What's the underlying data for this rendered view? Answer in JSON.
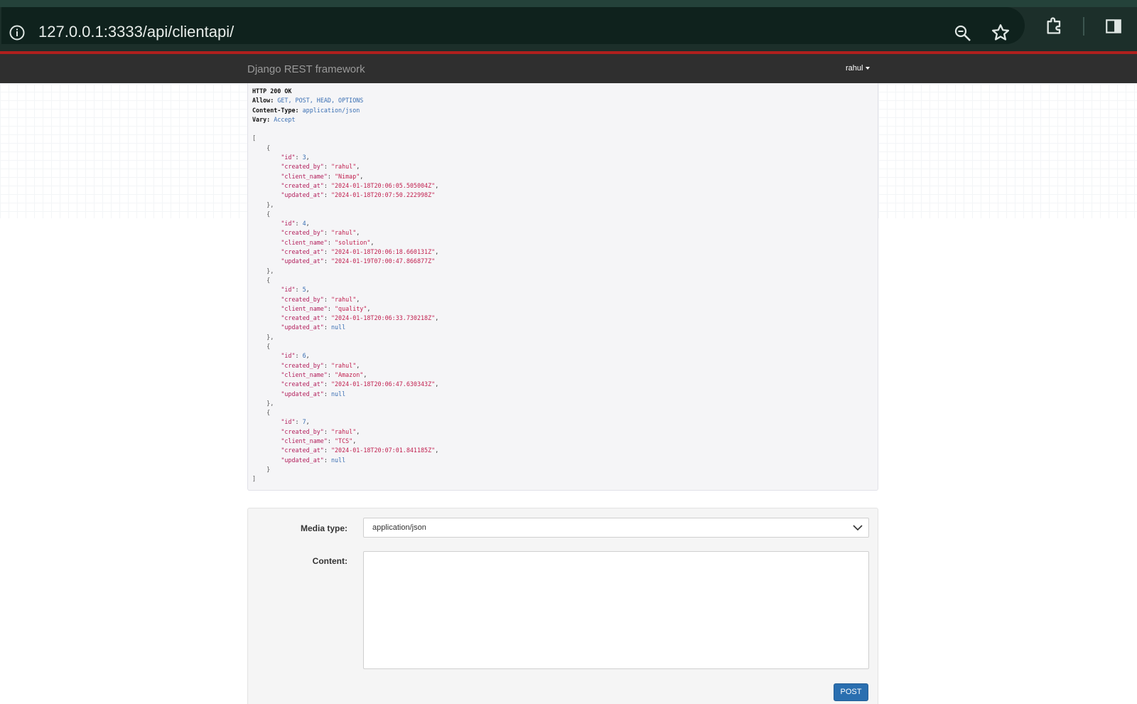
{
  "browser": {
    "url": "127.0.0.1:3333/api/clientapi/",
    "icons": [
      "info-icon",
      "zoom-icon",
      "bookmark-star-icon",
      "extensions-icon",
      "side-panel-icon"
    ]
  },
  "navbar": {
    "brand": "Django REST framework",
    "user": "rahul"
  },
  "response": {
    "status": "HTTP 200 OK",
    "headers": [
      {
        "key": "Allow:",
        "value": "GET, POST, HEAD, OPTIONS"
      },
      {
        "key": "Content-Type:",
        "value": "application/json"
      },
      {
        "key": "Vary:",
        "value": "Accept"
      }
    ],
    "records": [
      {
        "id": "3",
        "created_by": "\"rahul\"",
        "client_name": "\"Nimap\"",
        "created_at": "\"2024-01-18T20:06:05.505004Z\"",
        "updated_at": "\"2024-01-18T20:07:50.222998Z\""
      },
      {
        "id": "4",
        "created_by": "\"rahul\"",
        "client_name": "\"solution\"",
        "created_at": "\"2024-01-18T20:06:18.660131Z\"",
        "updated_at": "\"2024-01-19T07:00:47.866877Z\""
      },
      {
        "id": "5",
        "created_by": "\"rahul\"",
        "client_name": "\"quality\"",
        "created_at": "\"2024-01-18T20:06:33.730218Z\"",
        "updated_at": "null"
      },
      {
        "id": "6",
        "created_by": "\"rahul\"",
        "client_name": "\"Amazon\"",
        "created_at": "\"2024-01-18T20:06:47.630343Z\"",
        "updated_at": "null"
      },
      {
        "id": "7",
        "created_by": "\"rahul\"",
        "client_name": "\"TCS\"",
        "created_at": "\"2024-01-18T20:07:01.841185Z\"",
        "updated_at": "null"
      }
    ]
  },
  "form": {
    "media_type_label": "Media type:",
    "media_type_value": "application/json",
    "content_label": "Content:",
    "content_value": "",
    "post_label": "POST"
  },
  "colors": {
    "navbar": "#2f2f2f",
    "accent_red": "#b0201e",
    "post_button": "#2a6fb0"
  }
}
